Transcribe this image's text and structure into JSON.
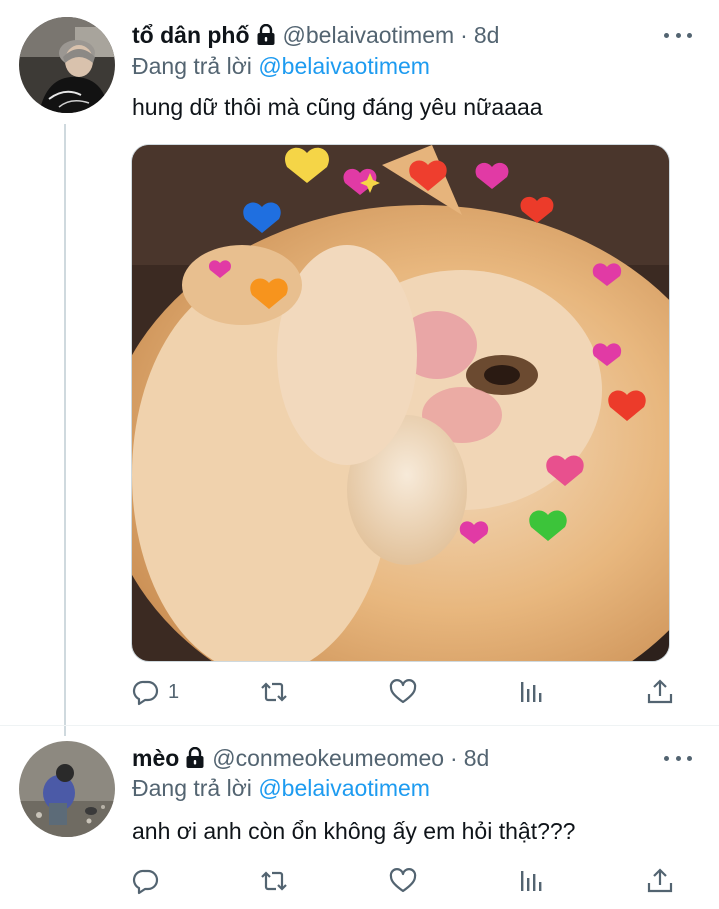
{
  "tweets": [
    {
      "name": "tổ dân phố",
      "handle": "@belaivaotimem",
      "separator": "·",
      "time": "8d",
      "reply_prefix": "Đang trả lời",
      "reply_to": "@belaivaotimem",
      "text": "hung dữ thôi mà cũng đáng yêu nữaaaa",
      "has_media": true,
      "media_desc_icons": [
        "heart-icon"
      ],
      "actions": {
        "reply_count": "1",
        "retweet_count": "",
        "like_count": "",
        "views_count": ""
      }
    },
    {
      "name": "mèo",
      "handle": "@conmeokeumeomeo",
      "separator": "·",
      "time": "8d",
      "reply_prefix": "Đang trả lời",
      "reply_to": "@belaivaotimem",
      "text": "anh ơi anh còn ổn không ấy em hỏi thật???",
      "has_media": false,
      "actions": {
        "reply_count": "",
        "retweet_count": "",
        "like_count": "",
        "views_count": ""
      }
    }
  ],
  "colors": {
    "link": "#1d9bf0",
    "secondary_text": "#536471",
    "primary_text": "#0f1419",
    "icon": "#536471"
  }
}
